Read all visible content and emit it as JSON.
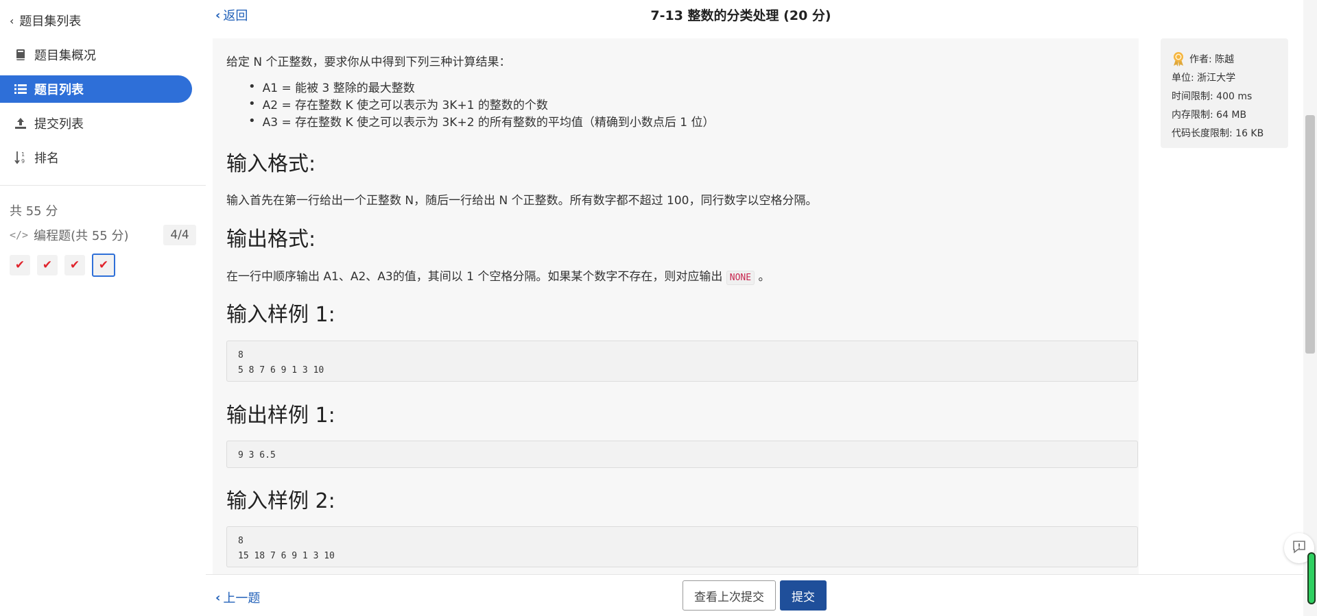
{
  "sidebar": {
    "back_label": "题目集列表",
    "items": [
      {
        "label": "题目集概况",
        "icon": "book-icon"
      },
      {
        "label": "题目列表",
        "icon": "list-icon",
        "active": true
      },
      {
        "label": "提交列表",
        "icon": "upload-icon"
      },
      {
        "label": "排名",
        "icon": "sort-numeric-icon"
      }
    ],
    "total_score": "共 55 分",
    "group_label": "编程题(共 55 分)",
    "group_count": "4/4",
    "problem_marks": [
      "✔",
      "✔",
      "✔",
      "✔"
    ]
  },
  "header": {
    "back_label": "返回",
    "title": "7-13 整数的分类处理 (20 分)"
  },
  "problem": {
    "intro": "给定 N 个正整数，要求你从中得到下列三种计算结果：",
    "conditions": [
      "A1 = 能被 3 整除的最大整数",
      "A2 = 存在整数 K 使之可以表示为 3K+1 的整数的个数",
      "A3 = 存在整数 K 使之可以表示为 3K+2 的所有整数的平均值（精确到小数点后 1 位）"
    ],
    "input_heading": "输入格式:",
    "input_text": "输入首先在第一行给出一个正整数 N，随后一行给出 N 个正整数。所有数字都不超过 100，同行数字以空格分隔。",
    "output_heading": "输出格式:",
    "output_text_before": "在一行中顺序输出 A1、A2、A3的值，其间以 1 个空格分隔。如果某个数字不存在，则对应输出",
    "output_code": "NONE",
    "output_text_after": "。",
    "sample_in1_heading": "输入样例 1:",
    "sample_in1": "8\n5 8 7 6 9 1 3 10",
    "sample_out1_heading": "输出样例 1:",
    "sample_out1": "9 3 6.5",
    "sample_in2_heading": "输入样例 2:",
    "sample_in2": "8\n15 18 7 6 9 1 3 10"
  },
  "info": {
    "author": "作者: 陈越",
    "unit": "单位: 浙江大学",
    "time_limit": "时间限制: 400 ms",
    "memory_limit": "内存限制: 64 MB",
    "code_limit": "代码长度限制: 16 KB"
  },
  "footer": {
    "prev_label": "上一题",
    "view_last_label": "查看上次提交",
    "submit_label": "提交"
  },
  "colors": {
    "accent": "#2e6fd8",
    "submit": "#1f4f9a",
    "check": "#e0242c",
    "link": "#1f5fb8"
  }
}
